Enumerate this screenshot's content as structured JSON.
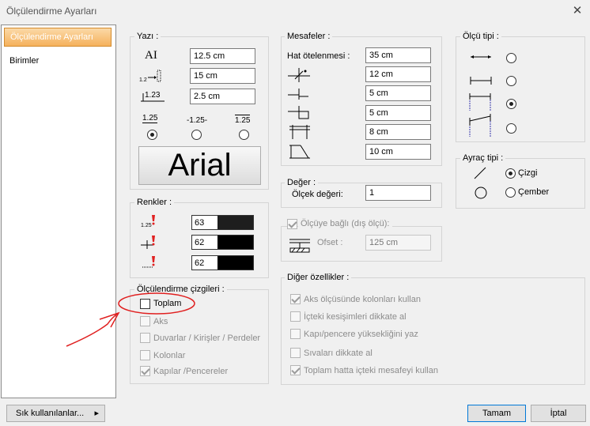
{
  "window": {
    "title": "Ölçülendirme Ayarları",
    "close_icon": "close-icon"
  },
  "sidebar": {
    "items": [
      {
        "label": "Ölçülendirme Ayarları"
      },
      {
        "label": "Birimler"
      }
    ]
  },
  "yazi": {
    "label": "Yazı :",
    "fields": [
      {
        "value": "12.5 cm"
      },
      {
        "value": "15 cm"
      },
      {
        "value": "2.5 cm"
      }
    ],
    "align_options": [
      {
        "text": "1.25"
      },
      {
        "text": "-1.25-"
      },
      {
        "text": "1.25"
      }
    ],
    "selected_align": 0,
    "font_button": "Arial"
  },
  "renkler": {
    "label": "Renkler :",
    "colors": [
      {
        "value": "63",
        "hex": "#1e1e1e"
      },
      {
        "value": "62",
        "hex": "#000000"
      },
      {
        "value": "62",
        "hex": "#000000"
      }
    ]
  },
  "cizgiler": {
    "label": "Ölçülendirme çizgileri :",
    "items": [
      {
        "label": "Toplam",
        "checked": false,
        "disabled": false
      },
      {
        "label": "Aks",
        "checked": false,
        "disabled": true
      },
      {
        "label": "Duvarlar / Kirişler / Perdeler",
        "checked": false,
        "disabled": true
      },
      {
        "label": "Kolonlar",
        "checked": false,
        "disabled": true
      },
      {
        "label": "Kapılar /Pencereler",
        "checked": true,
        "disabled": true
      }
    ]
  },
  "mesafeler": {
    "label": "Mesafeler :",
    "hat_label": "Hat ötelenmesi :",
    "values": [
      "35 cm",
      "12 cm",
      "5 cm",
      "5 cm",
      "8 cm",
      "10 cm"
    ]
  },
  "deger": {
    "label": "Değer :",
    "field_label": "Ölçek değeri:",
    "value": "1"
  },
  "olcuye_bagli": {
    "label": "Ölçüye bağlı (dış ölçü):",
    "checked": true,
    "ofset_label": "Ofset :",
    "ofset_value": "125 cm"
  },
  "diger": {
    "label": "Diğer özellikler :",
    "items": [
      {
        "label": "Aks ölçüsünde kolonları kullan",
        "checked": true
      },
      {
        "label": "İçteki kesişimleri dikkate al",
        "checked": false
      },
      {
        "label": "Kapı/pencere yüksekliğini yaz",
        "checked": false
      },
      {
        "label": "Sıvaları dikkate al",
        "checked": false
      },
      {
        "label": "Toplam hatta içteki mesafeyi kullan",
        "checked": true
      }
    ]
  },
  "olcu_tipi": {
    "label": "Ölçü tipi :",
    "selected": 2
  },
  "ayrac_tipi": {
    "label": "Ayraç tipi :",
    "options": [
      {
        "label": "Çizgi"
      },
      {
        "label": "Çember"
      }
    ],
    "selected": 0
  },
  "footer": {
    "frequent": "Sık kullanılanlar...",
    "frequent_arrow": "▸",
    "ok": "Tamam",
    "cancel": "İptal"
  },
  "annotation": {
    "color": "#e02020"
  }
}
